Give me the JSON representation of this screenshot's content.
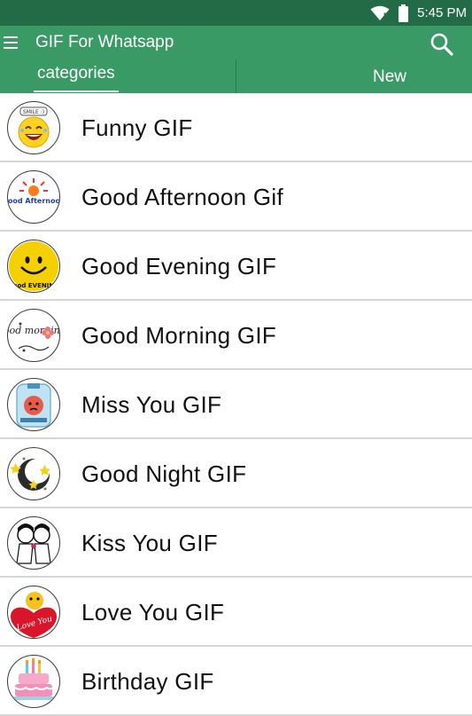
{
  "status_bar": {
    "time": "5:45 PM",
    "wifi_icon": "wifi-icon",
    "battery_icon": "battery-icon"
  },
  "app_bar": {
    "title": "GIF For Whatsapp",
    "menu_icon": "hamburger-menu-icon",
    "search_icon": "search-icon",
    "background": "#3a9a66",
    "status_background": "#236b46"
  },
  "tabs": [
    {
      "label": "categories",
      "selected": true
    },
    {
      "label": "New",
      "selected": false
    }
  ],
  "categories": [
    {
      "label": "Funny GIF",
      "icon": "laughing-smiley-icon",
      "badge_text": "SMILE :)"
    },
    {
      "label": "Good Afternoon Gif",
      "icon": "sun-afternoon-icon",
      "badge_text": "Good Afternoon"
    },
    {
      "label": "Good Evening GIF",
      "icon": "yellow-smiley-icon",
      "badge_text": "Good EVENING"
    },
    {
      "label": "Good Morning GIF",
      "icon": "good-morning-flower-icon",
      "badge_text": "Good morning"
    },
    {
      "label": "Miss You GIF",
      "icon": "miss-you-jar-icon",
      "badge_text": ""
    },
    {
      "label": "Good Night GIF",
      "icon": "moon-stars-icon",
      "badge_text": ""
    },
    {
      "label": "Kiss You GIF",
      "icon": "kissing-couple-icon",
      "badge_text": ""
    },
    {
      "label": "Love You GIF",
      "icon": "heart-love-you-icon",
      "badge_text": "Love You"
    },
    {
      "label": "Birthday GIF",
      "icon": "birthday-cake-icon",
      "badge_text": ""
    }
  ]
}
